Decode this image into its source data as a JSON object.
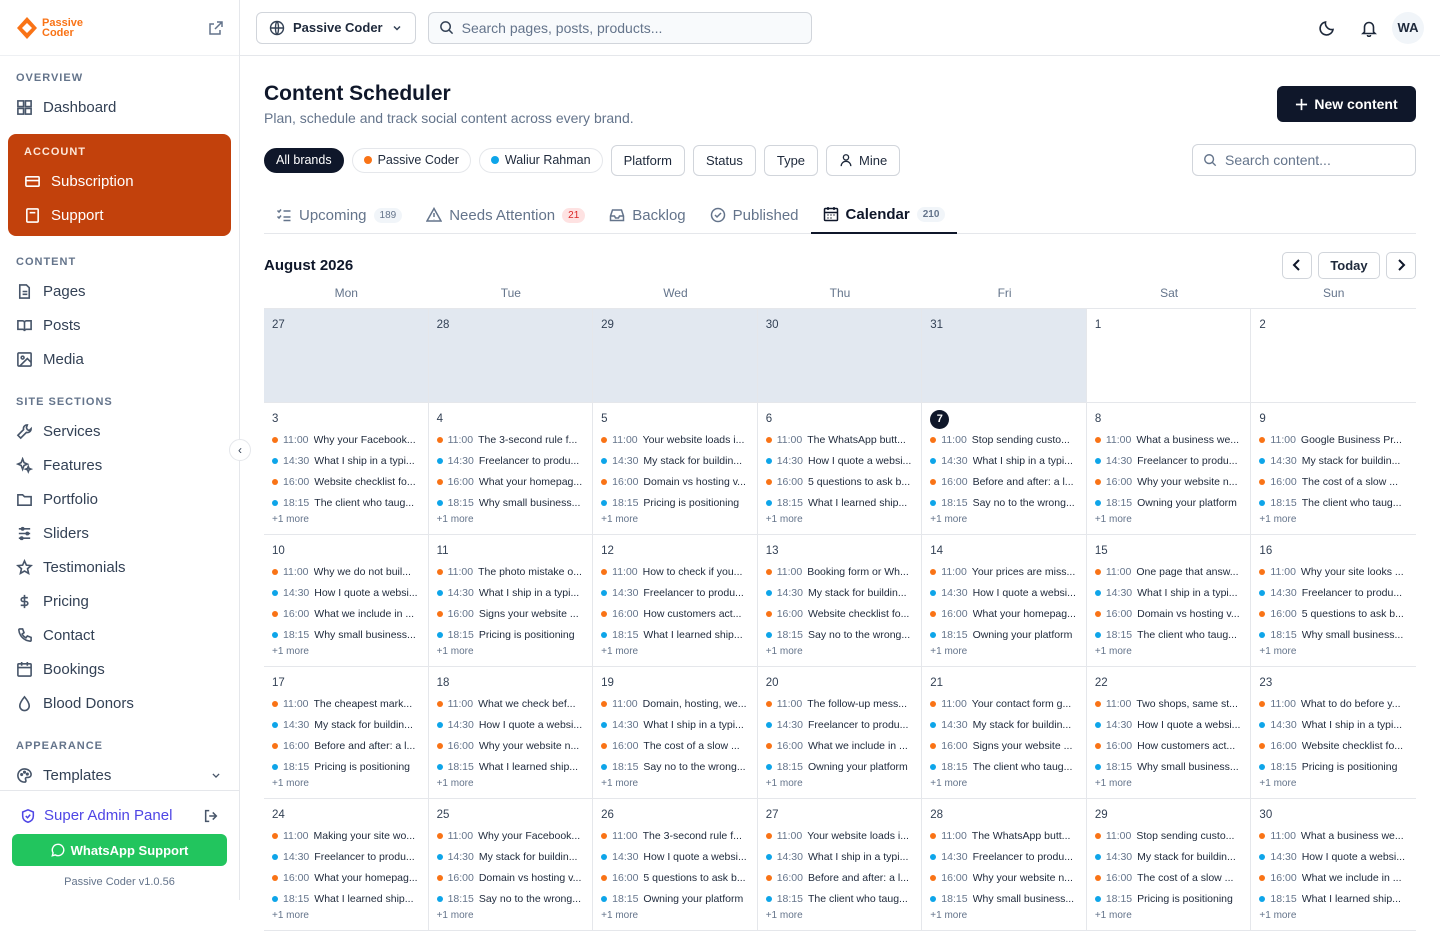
{
  "app": {
    "logo_text_1": "Passive",
    "logo_text_2": "Coder"
  },
  "sidebar": {
    "overview_label": "OVERVIEW",
    "dashboard": "Dashboard",
    "account_label": "ACCOUNT",
    "account_items": [
      "Subscription",
      "Support"
    ],
    "content_label": "CONTENT",
    "content_items": [
      "Pages",
      "Posts",
      "Media"
    ],
    "site_label": "SITE SECTIONS",
    "site_items": [
      "Services",
      "Features",
      "Portfolio",
      "Sliders",
      "Testimonials",
      "Pricing",
      "Contact",
      "Bookings",
      "Blood Donors"
    ],
    "appearance_label": "APPEARANCE",
    "templates": "Templates",
    "super_admin": "Super Admin Panel",
    "whatsapp": "WhatsApp Support",
    "version": "Passive Coder v1.0.56"
  },
  "topbar": {
    "brand": "Passive Coder",
    "search_placeholder": "Search pages, posts, products...",
    "avatar": "WA"
  },
  "page": {
    "title": "Content Scheduler",
    "subtitle": "Plan, schedule and track social content across every brand.",
    "new_button": "New content"
  },
  "filters": {
    "chips": [
      {
        "label": "All brands",
        "color": ""
      },
      {
        "label": "Passive Coder",
        "color": "#f97316"
      },
      {
        "label": "Waliur Rahman",
        "color": "#0ea5e9"
      }
    ],
    "buttons": [
      "Platform",
      "Status",
      "Type",
      "Mine"
    ],
    "search_placeholder": "Search content..."
  },
  "tabs": [
    {
      "label": "Upcoming",
      "count": "189"
    },
    {
      "label": "Needs Attention",
      "count": "21"
    },
    {
      "label": "Backlog",
      "count": ""
    },
    {
      "label": "Published",
      "count": ""
    },
    {
      "label": "Calendar",
      "count": "210"
    }
  ],
  "calendar": {
    "month": "August 2026",
    "today_label": "Today",
    "days_of_week": [
      "Mon",
      "Tue",
      "Wed",
      "Thu",
      "Fri",
      "Sat",
      "Sun"
    ],
    "colors": {
      "orange": "#f97316",
      "blue": "#0ea5e9"
    },
    "times": [
      "11:00",
      "14:30",
      "16:00",
      "18:15"
    ],
    "more": "+1 more",
    "weeks": [
      [
        {
          "d": "27",
          "out": true
        },
        {
          "d": "28",
          "out": true
        },
        {
          "d": "29",
          "out": true
        },
        {
          "d": "30",
          "out": true
        },
        {
          "d": "31",
          "out": true
        },
        {
          "d": "1",
          "out": false
        },
        {
          "d": "2",
          "out": false
        }
      ],
      [
        {
          "d": "3",
          "ev": [
            "Why your Facebook...",
            "What I ship in a typi...",
            "Website checklist fo...",
            "The client who taug..."
          ]
        },
        {
          "d": "4",
          "ev": [
            "The 3-second rule f...",
            "Freelancer to produ...",
            "What your homepag...",
            "Why small business..."
          ]
        },
        {
          "d": "5",
          "ev": [
            "Your website loads i...",
            "My stack for buildin...",
            "Domain vs hosting v...",
            "Pricing is positioning"
          ]
        },
        {
          "d": "6",
          "ev": [
            "The WhatsApp butt...",
            "How I quote a websi...",
            "5 questions to ask b...",
            "What I learned ship..."
          ]
        },
        {
          "d": "7",
          "today": true,
          "ev": [
            "Stop sending custo...",
            "What I ship in a typi...",
            "Before and after: a l...",
            "Say no to the wrong..."
          ]
        },
        {
          "d": "8",
          "ev": [
            "What a business we...",
            "Freelancer to produ...",
            "Why your website n...",
            "Owning your platform"
          ]
        },
        {
          "d": "9",
          "ev": [
            "Google Business Pr...",
            "My stack for buildin...",
            "The cost of a slow ...",
            "The client who taug..."
          ]
        }
      ],
      [
        {
          "d": "10",
          "ev": [
            "Why we do not buil...",
            "How I quote a websi...",
            "What we include in ...",
            "Why small business..."
          ]
        },
        {
          "d": "11",
          "ev": [
            "The photo mistake o...",
            "What I ship in a typi...",
            "Signs your website ...",
            "Pricing is positioning"
          ]
        },
        {
          "d": "12",
          "ev": [
            "How to check if you...",
            "Freelancer to produ...",
            "How customers act...",
            "What I learned ship..."
          ]
        },
        {
          "d": "13",
          "ev": [
            "Booking form or Wh...",
            "My stack for buildin...",
            "Website checklist fo...",
            "Say no to the wrong..."
          ]
        },
        {
          "d": "14",
          "ev": [
            "Your prices are miss...",
            "How I quote a websi...",
            "What your homepag...",
            "Owning your platform"
          ]
        },
        {
          "d": "15",
          "ev": [
            "One page that answ...",
            "What I ship in a typi...",
            "Domain vs hosting v...",
            "The client who taug..."
          ]
        },
        {
          "d": "16",
          "ev": [
            "Why your site looks ...",
            "Freelancer to produ...",
            "5 questions to ask b...",
            "Why small business..."
          ]
        }
      ],
      [
        {
          "d": "17",
          "ev": [
            "The cheapest mark...",
            "My stack for buildin...",
            "Before and after: a l...",
            "Pricing is positioning"
          ]
        },
        {
          "d": "18",
          "ev": [
            "What we check bef...",
            "How I quote a websi...",
            "Why your website n...",
            "What I learned ship..."
          ]
        },
        {
          "d": "19",
          "ev": [
            "Domain, hosting, we...",
            "What I ship in a typi...",
            "The cost of a slow ...",
            "Say no to the wrong..."
          ]
        },
        {
          "d": "20",
          "ev": [
            "The follow-up mess...",
            "Freelancer to produ...",
            "What we include in ...",
            "Owning your platform"
          ]
        },
        {
          "d": "21",
          "ev": [
            "Your contact form g...",
            "My stack for buildin...",
            "Signs your website ...",
            "The client who taug..."
          ]
        },
        {
          "d": "22",
          "ev": [
            "Two shops, same st...",
            "How I quote a websi...",
            "How customers act...",
            "Why small business..."
          ]
        },
        {
          "d": "23",
          "ev": [
            "What to do before y...",
            "What I ship in a typi...",
            "Website checklist fo...",
            "Pricing is positioning"
          ]
        }
      ],
      [
        {
          "d": "24",
          "ev": [
            "Making your site wo...",
            "Freelancer to produ...",
            "What your homepag...",
            "What I learned ship..."
          ]
        },
        {
          "d": "25",
          "ev": [
            "Why your Facebook...",
            "My stack for buildin...",
            "Domain vs hosting v...",
            "Say no to the wrong..."
          ]
        },
        {
          "d": "26",
          "ev": [
            "The 3-second rule f...",
            "How I quote a websi...",
            "5 questions to ask b...",
            "Owning your platform"
          ]
        },
        {
          "d": "27",
          "ev": [
            "Your website loads i...",
            "What I ship in a typi...",
            "Before and after: a l...",
            "The client who taug..."
          ]
        },
        {
          "d": "28",
          "ev": [
            "The WhatsApp butt...",
            "Freelancer to produ...",
            "Why your website n...",
            "Why small business..."
          ]
        },
        {
          "d": "29",
          "ev": [
            "Stop sending custo...",
            "My stack for buildin...",
            "The cost of a slow ...",
            "Pricing is positioning"
          ]
        },
        {
          "d": "30",
          "ev": [
            "What a business we...",
            "How I quote a websi...",
            "What we include in ...",
            "What I learned ship..."
          ]
        }
      ]
    ]
  }
}
